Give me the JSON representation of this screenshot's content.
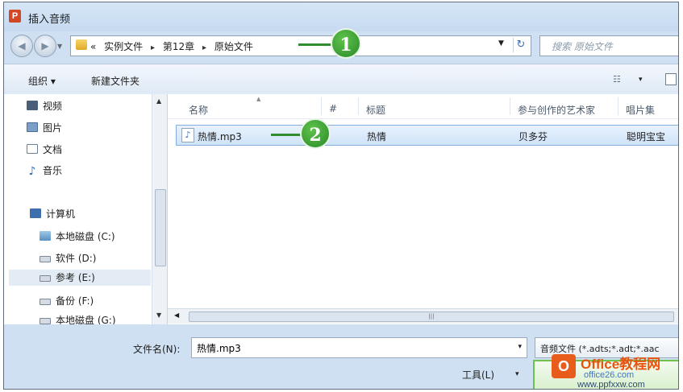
{
  "window": {
    "title": "插入音频",
    "app_icon_letter": "P"
  },
  "address": {
    "overflow": "«",
    "crumbs": [
      "实例文件",
      "第12章",
      "原始文件"
    ],
    "separator": "▸",
    "search_placeholder": "搜索 原始文件"
  },
  "toolbar": {
    "organize": "组织 ▾",
    "new_folder": "新建文件夹",
    "view": "☷",
    "view_dropdown": "▾"
  },
  "nav": {
    "items": [
      {
        "label": "视频",
        "icon": "video-library-icon"
      },
      {
        "label": "图片",
        "icon": "pictures-library-icon"
      },
      {
        "label": "文档",
        "icon": "documents-library-icon"
      },
      {
        "label": "音乐",
        "icon": "music-library-icon"
      },
      {
        "label": "计算机",
        "icon": "computer-icon"
      },
      {
        "label": "本地磁盘 (C:)",
        "icon": "local-disk-icon"
      },
      {
        "label": "软件 (D:)",
        "icon": "drive-icon"
      },
      {
        "label": "参考 (E:)",
        "icon": "drive-icon"
      },
      {
        "label": "备份 (F:)",
        "icon": "drive-icon"
      },
      {
        "label": "本地磁盘 (G:)",
        "icon": "drive-icon"
      }
    ],
    "selected": "参考 (E:)"
  },
  "columns": [
    "名称",
    "#",
    "标题",
    "参与创作的艺术家",
    "唱片集"
  ],
  "files": [
    {
      "name": "热情.mp3",
      "number": "",
      "title": "热情",
      "artist": "贝多芬",
      "album": "聪明宝宝"
    }
  ],
  "bottom": {
    "filename_label": "文件名(N):",
    "filename_value": "热情.mp3",
    "filetype": "音频文件 (*.adts;*.adt;*.aac",
    "tools_label": "工具(L)",
    "dropdown_arrow": "▾"
  },
  "callouts": [
    "1",
    "2"
  ],
  "watermark": {
    "badge": "O",
    "brand": "Office教程网",
    "sub": "office26.com",
    "url": "www.ppfxxw.com"
  },
  "colors": {
    "callout": "#2f8c2f",
    "selection": "#cfe3f8",
    "frame": "#cfe0f2"
  }
}
